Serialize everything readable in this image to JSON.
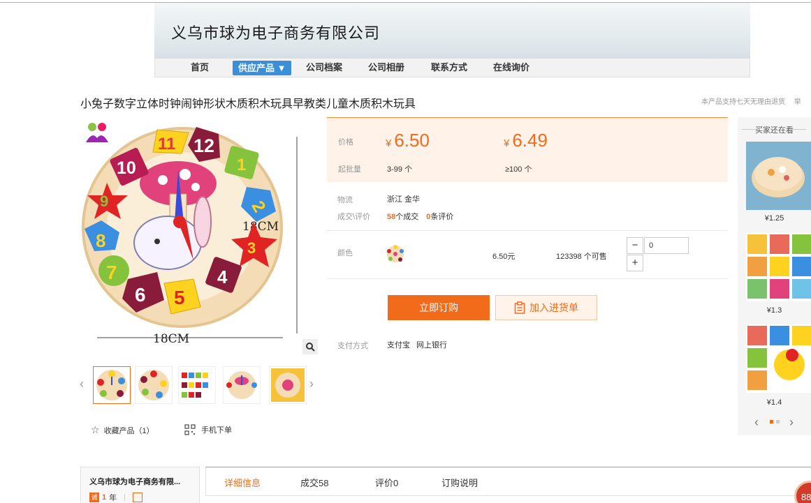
{
  "header": {
    "company_name": "义乌市球为电子商务有限公司"
  },
  "nav": {
    "items": [
      {
        "label": "首页"
      },
      {
        "label": "供应产品 ▼",
        "active": true
      },
      {
        "label": "公司档案"
      },
      {
        "label": "公司相册"
      },
      {
        "label": "联系方式"
      },
      {
        "label": "在线询价"
      }
    ]
  },
  "product": {
    "title": "小兔子数字立体时钟闹钟形状木质积木玩具早教类儿童木质积木玩具",
    "promise": "本产品支持七天无理由退货",
    "promise_extra": "举",
    "image_dimension_label": "18CM",
    "image_dimension_label_2": "18CM"
  },
  "gallery": {
    "thumbnail_count": 5
  },
  "actions": {
    "favorite": "收藏产品（1）",
    "mobile_order": "手机下单"
  },
  "price": {
    "label": "价格",
    "currency": "¥",
    "tier1_price": "6.50",
    "tier2_price": "6.49",
    "moq_label": "起批量",
    "tier1_range": "3-99 个",
    "tier2_range": "≥100 个"
  },
  "logistics": {
    "label": "物流",
    "value": "浙江 金华"
  },
  "deals": {
    "label": "成交\\评价",
    "deal_count": "58",
    "deal_suffix": "个成交",
    "review_count": "0",
    "review_suffix": "条评价"
  },
  "variant": {
    "label": "颜色",
    "unit_price": "6.50元",
    "stock": "123398 个可售",
    "quantity": "0",
    "minus": "−",
    "plus": "+"
  },
  "buttons": {
    "buy_now": "立即订购",
    "add_to_cart": "加入进货单"
  },
  "payment": {
    "label": "支付方式",
    "method1": "支付宝",
    "method2": "网上银行"
  },
  "sidebar": {
    "title": "买家还在看",
    "items": [
      {
        "price": "¥1.25"
      },
      {
        "price": "¥1.3"
      },
      {
        "price": "¥1.4"
      }
    ]
  },
  "bottom": {
    "shop_name": "义乌市球为电子商务有限...",
    "years": "1",
    "years_suffix": "年",
    "tabs": [
      {
        "label": "详细信息"
      },
      {
        "label": "成交58"
      },
      {
        "label": "评价0"
      },
      {
        "label": "订购说明"
      }
    ],
    "float_badge": "88"
  },
  "colors": {
    "accent": "#f26b1b",
    "nav_active": "#3a8fd8",
    "price_bg": "#fff2e8"
  }
}
